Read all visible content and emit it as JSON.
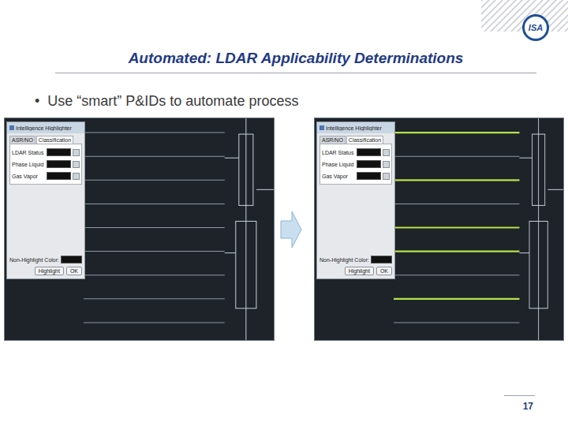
{
  "slide": {
    "title": "Automated: LDAR Applicability Determinations",
    "bullet_mark": "•",
    "bullet": "Use “smart” P&IDs to automate process",
    "logo": "ISA",
    "page_number": "17"
  },
  "screenshots": [
    {
      "dialog": {
        "title": "Intelligence Highlighter",
        "tabs": [
          {
            "label": "ASR/NO",
            "selected": false
          },
          {
            "label": "Classification",
            "selected": true
          }
        ],
        "fields": [
          {
            "label": "LDAR Status"
          },
          {
            "label": "Phase Liquid"
          },
          {
            "label": "Gas Vapor"
          }
        ],
        "non_highlight_label": "Non-Highlight Color:",
        "buttons": [
          "Highlight",
          "OK"
        ]
      },
      "pipes": [
        {
          "highlighted": false
        },
        {
          "highlighted": false
        },
        {
          "highlighted": false
        },
        {
          "highlighted": false
        },
        {
          "highlighted": false
        },
        {
          "highlighted": false
        },
        {
          "highlighted": false
        },
        {
          "highlighted": false
        },
        {
          "highlighted": false
        }
      ]
    },
    {
      "dialog": {
        "title": "Intelligence Highlighter",
        "tabs": [
          {
            "label": "ASR/NO",
            "selected": false
          },
          {
            "label": "Classification",
            "selected": true
          }
        ],
        "fields": [
          {
            "label": "LDAR Status"
          },
          {
            "label": "Phase Liquid"
          },
          {
            "label": "Gas Vapor"
          }
        ],
        "non_highlight_label": "Non-Highlight Color:",
        "buttons": [
          "Highlight",
          "OK"
        ]
      },
      "pipes": [
        {
          "highlighted": true
        },
        {
          "highlighted": false
        },
        {
          "highlighted": true
        },
        {
          "highlighted": false
        },
        {
          "highlighted": true
        },
        {
          "highlighted": true
        },
        {
          "highlighted": false
        },
        {
          "highlighted": true
        },
        {
          "highlighted": false
        }
      ]
    }
  ]
}
